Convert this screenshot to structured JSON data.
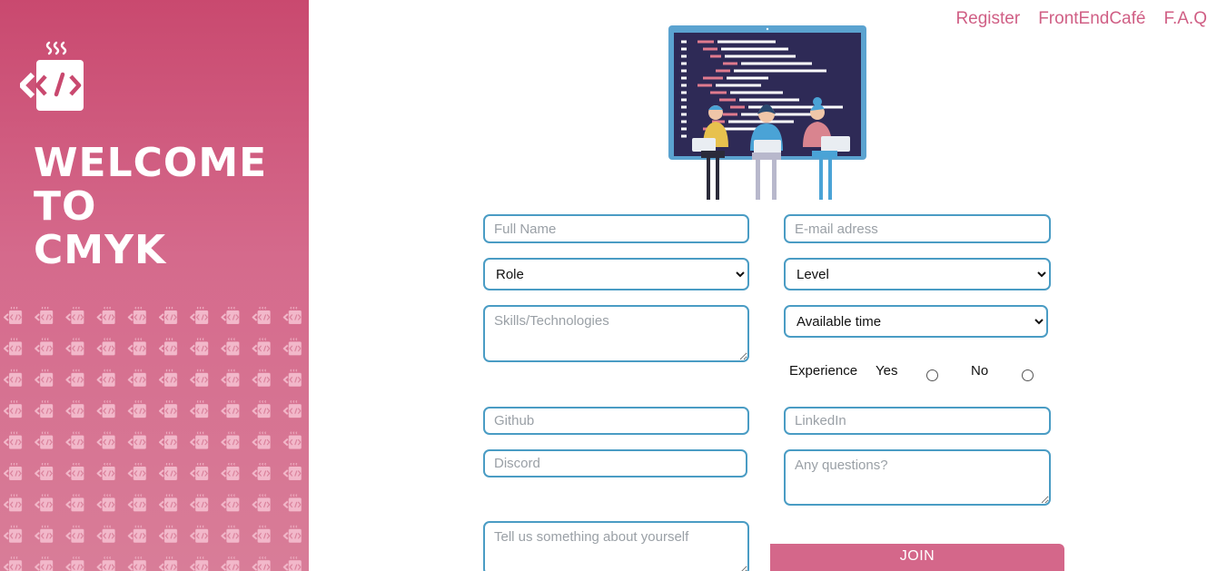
{
  "sidebar": {
    "welcome_lines": [
      "WELCOME",
      "TO",
      "CMYK"
    ],
    "logo_icon": "code-mug-icon",
    "pattern_icon": "code-mug-icon",
    "background_color": "#d06689"
  },
  "nav": {
    "links": [
      "Register",
      "FrontEndCafé",
      "F.A.Q"
    ],
    "color": "#d05f85"
  },
  "illustration": {
    "icon": "developers-laptop-illustration"
  },
  "form": {
    "full_name": {
      "placeholder": "Full Name",
      "value": ""
    },
    "email": {
      "placeholder": "E-mail adress",
      "value": ""
    },
    "role": {
      "selected": "Role"
    },
    "level": {
      "selected": "Level"
    },
    "skills": {
      "placeholder": "Skills/Technologies",
      "value": ""
    },
    "available_time": {
      "selected": "Available time"
    },
    "experience": {
      "label": "Experience",
      "yes_label": "Yes",
      "no_label": "No"
    },
    "github": {
      "placeholder": "Github",
      "value": ""
    },
    "linkedin": {
      "placeholder": "LinkedIn",
      "value": ""
    },
    "discord": {
      "placeholder": "Discord",
      "value": ""
    },
    "questions": {
      "placeholder": "Any questions?",
      "value": ""
    },
    "about": {
      "placeholder": "Tell us something about yourself",
      "value": ""
    },
    "join_label": "JOIN",
    "accent_color": "#4a9cc4",
    "button_color": "#d4678a"
  }
}
